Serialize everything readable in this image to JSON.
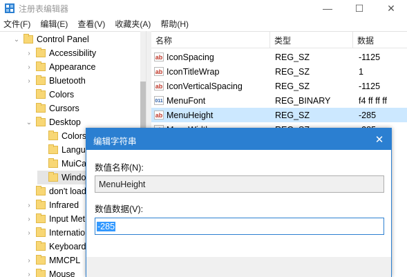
{
  "window": {
    "title": "注册表编辑器",
    "minimize_glyph": "—",
    "maximize_glyph": "☐",
    "close_glyph": "✕"
  },
  "menu": [
    "文件(F)",
    "编辑(E)",
    "查看(V)",
    "收藏夹(A)",
    "帮助(H)"
  ],
  "tree": {
    "items": [
      {
        "label": "Control Panel",
        "expanded": true
      },
      {
        "label": "Accessibility",
        "expanded": false
      },
      {
        "label": "Appearance",
        "expanded": false
      },
      {
        "label": "Bluetooth",
        "expanded": false
      },
      {
        "label": "Colors",
        "expanded": false
      },
      {
        "label": "Cursors",
        "expanded": false
      },
      {
        "label": "Desktop",
        "expanded": true
      },
      {
        "label": "Colors",
        "expanded": false
      },
      {
        "label": "LanguageConfiguration",
        "expanded": false
      },
      {
        "label": "MuiCached",
        "expanded": false
      },
      {
        "label": "WindowMetrics",
        "expanded": false,
        "selected": true
      },
      {
        "label": "don't load",
        "expanded": false
      },
      {
        "label": "Infrared",
        "expanded": false
      },
      {
        "label": "Input Method",
        "expanded": false
      },
      {
        "label": "International",
        "expanded": false
      },
      {
        "label": "Keyboard",
        "expanded": false
      },
      {
        "label": "MMCPL",
        "expanded": false
      },
      {
        "label": "Mouse",
        "expanded": false
      }
    ]
  },
  "list": {
    "headers": [
      "名称",
      "类型",
      "数据"
    ],
    "rows": [
      {
        "name": "IconSpacing",
        "type": "REG_SZ",
        "data": "-1125",
        "icon": "string-value-icon"
      },
      {
        "name": "IconTitleWrap",
        "type": "REG_SZ",
        "data": "1",
        "icon": "string-value-icon"
      },
      {
        "name": "IconVerticalSpacing",
        "type": "REG_SZ",
        "data": "-1125",
        "icon": "string-value-icon"
      },
      {
        "name": "MenuFont",
        "type": "REG_BINARY",
        "data": "f4 ff ff ff",
        "icon": "binary-value-icon"
      },
      {
        "name": "MenuHeight",
        "type": "REG_SZ",
        "data": "-285",
        "icon": "string-value-icon",
        "selected": true
      },
      {
        "name": "MenuWidth",
        "type": "REG_SZ",
        "data": "-285",
        "icon": "string-value-icon"
      }
    ]
  },
  "dialog": {
    "title": "编辑字符串",
    "close_glyph": "✕",
    "name_label": "数值名称(N):",
    "name_value": "MenuHeight",
    "data_label": "数值数据(V):",
    "data_value": "-285"
  },
  "colors": {
    "accent": "#2b7fd1",
    "selection": "#cce8ff",
    "text_selection": "#3399ff",
    "folder": "#f8d775"
  }
}
